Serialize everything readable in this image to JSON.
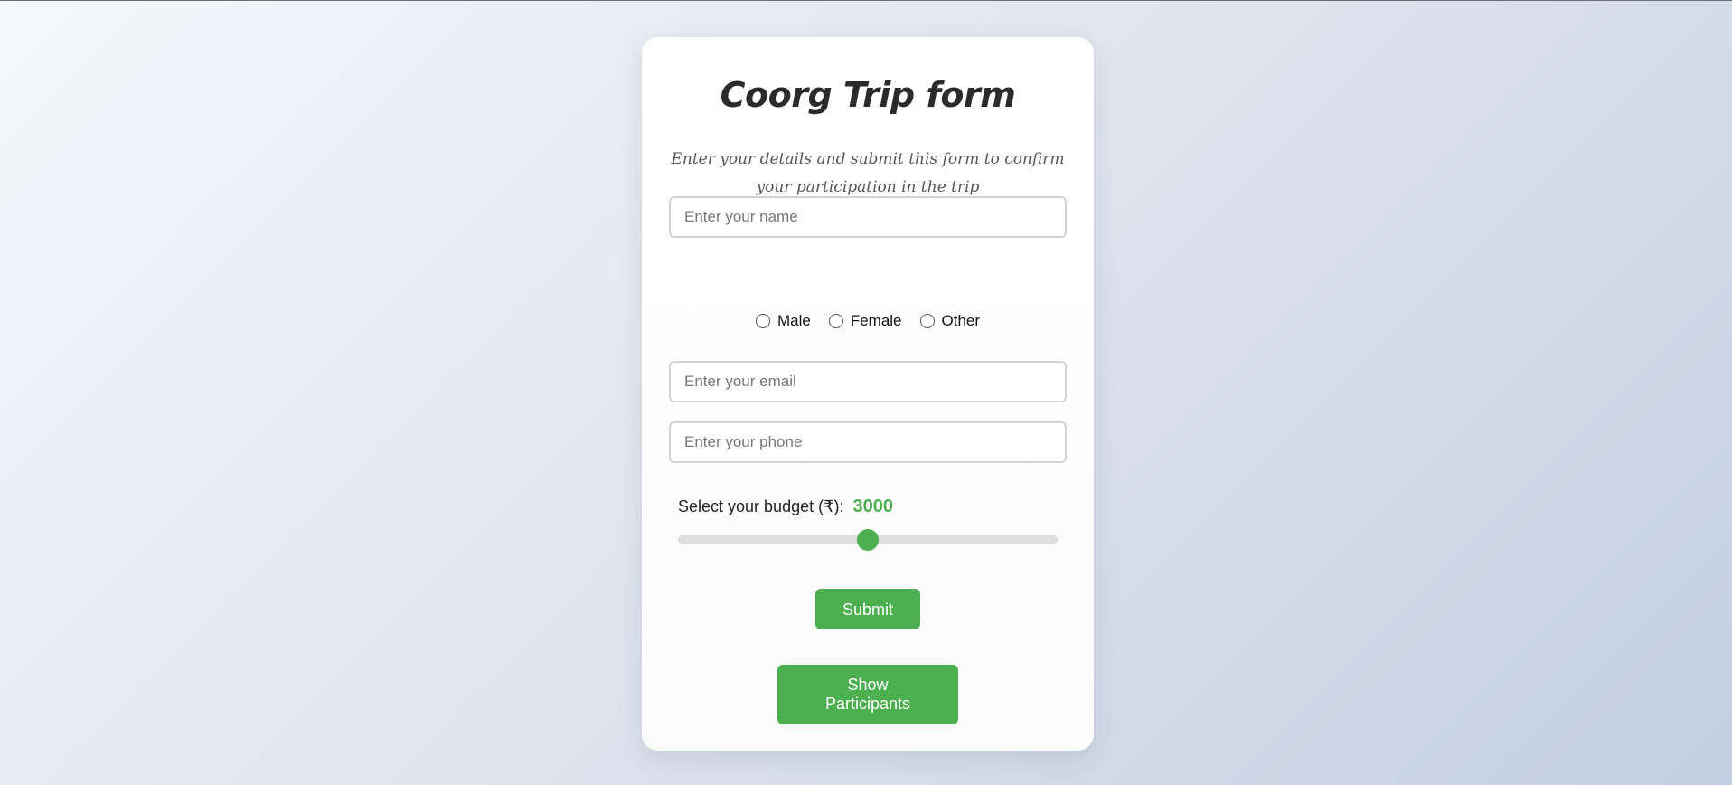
{
  "form": {
    "title": "Coorg Trip form",
    "subtitle": "Enter your details and submit this form to confirm your participation in the trip",
    "name_placeholder": "Enter your name",
    "name_value": "",
    "gender_options": [
      "Male",
      "Female",
      "Other"
    ],
    "gender_selected": null,
    "email_placeholder": "Enter your email",
    "email_value": "",
    "phone_placeholder": "Enter your phone",
    "phone_value": "",
    "budget_label": "Select your budget (₹):",
    "budget_value": "3000",
    "budget_level": 0.5,
    "submit_label": "Submit",
    "show_participants_label": "Show Participants"
  },
  "colors": {
    "accent": "#4caf50",
    "title": "#2b2b2b",
    "subtitle": "#555555",
    "input_border": "#d3d3d3",
    "slider_track": "#dedede"
  },
  "icons": {
    "radio": "radio-unchecked-circle"
  }
}
